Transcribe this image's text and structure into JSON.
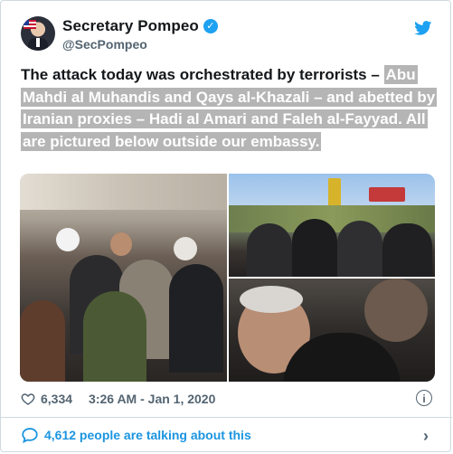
{
  "author": {
    "display_name": "Secretary Pompeo",
    "handle": "@SecPompeo",
    "verified": true
  },
  "tweet": {
    "lead_text": "The attack today was orchestrated by terrorists – ",
    "highlighted_text": "Abu Mahdi al Muhandis and Qays al-Khazali – and abetted by Iranian proxies – Hadi al Amari and Faleh al-Fayyad. All are pictured below outside our embassy."
  },
  "media": {
    "photos": [
      "crowd-photo",
      "group-photo",
      "closeup-photo"
    ]
  },
  "stats": {
    "likes": "6,334",
    "timestamp": "3:26 AM - Jan 1, 2020"
  },
  "conversation": {
    "label": "4,612 people are talking about this"
  },
  "icons": {
    "verified": "verified-badge-icon",
    "brand": "twitter-bird-icon",
    "like": "heart-icon",
    "info": "info-icon",
    "talk": "comment-bubble-icon",
    "chevron": "chevron-right-icon"
  },
  "colors": {
    "brand_blue": "#1da1f2",
    "link_blue": "#1b95e0",
    "highlight_bg": "#b5b5b5",
    "muted_text": "#536471"
  }
}
